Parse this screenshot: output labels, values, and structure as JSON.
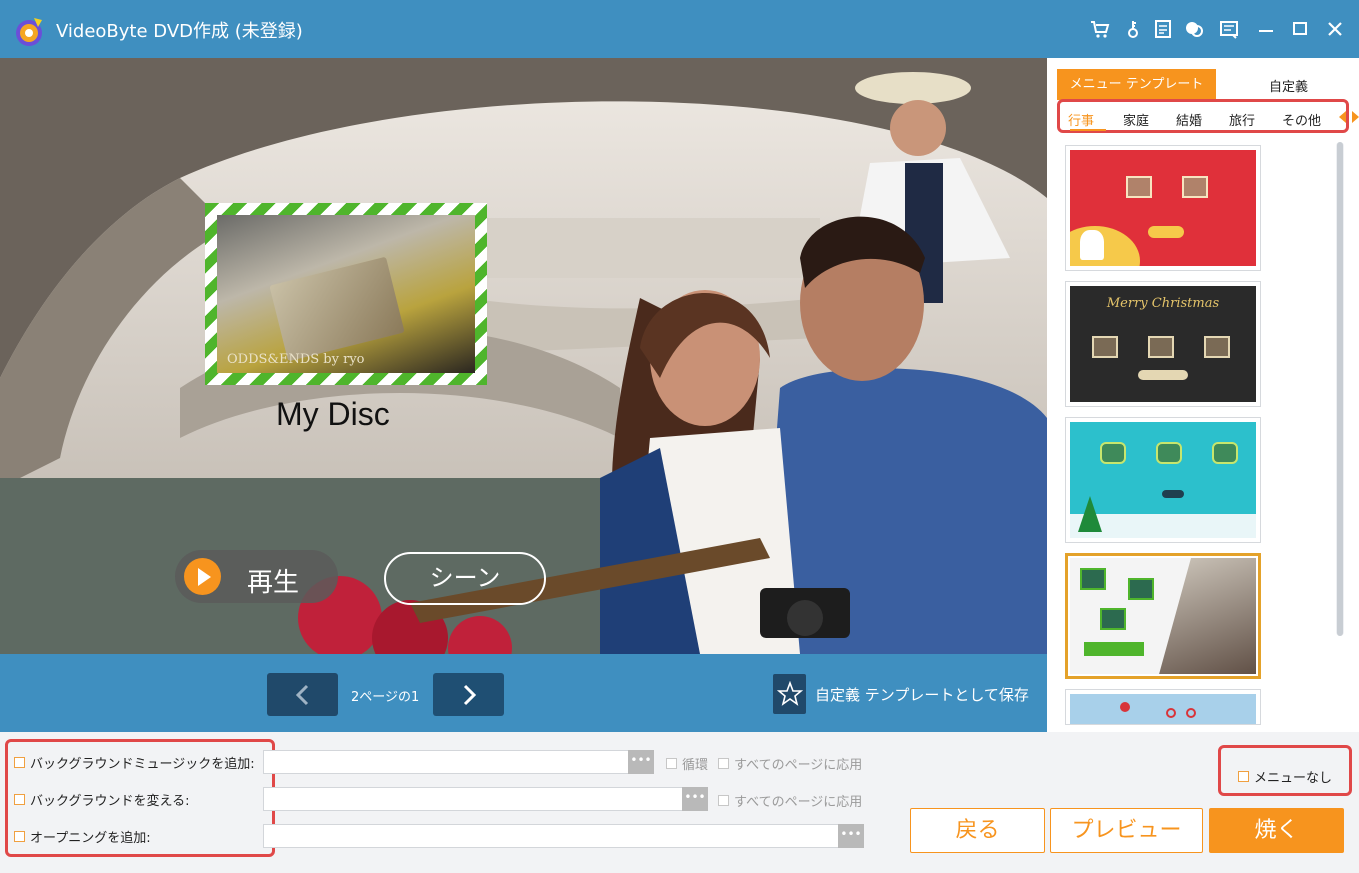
{
  "window": {
    "title": "VideoByte DVD作成 (未登録)",
    "toolbar_icons": [
      "cart-icon",
      "key-icon",
      "document-icon",
      "chat-icon",
      "feedback-icon",
      "minimize-icon",
      "maximize-icon",
      "close-icon"
    ]
  },
  "preview": {
    "disc_title": "My Disc",
    "thumbnail_caption": "ODDS&ENDS by ryo",
    "play_label": "再生",
    "scene_label": "シーン"
  },
  "pager": {
    "page_label": "2ページの1",
    "save_template_label": "自定義 テンプレートとして保存"
  },
  "panel": {
    "tab_menu_template": "メニュー テンプレート",
    "tab_custom": "自定義",
    "categories": [
      "行事",
      "家庭",
      "結婚",
      "旅行",
      "その他"
    ],
    "active_category": "行事",
    "selected_template_index": 3,
    "template_texts": {
      "christmas_script": "Merry Christmas"
    }
  },
  "options": {
    "add_bgm_label": "バックグラウンドミュージックを追加:",
    "change_bg_label": "バックグラウンドを変える:",
    "add_opening_label": "オープニングを追加:",
    "loop_label": "循環",
    "apply_all_label": "すべてのページに応用",
    "browse_label": "•••",
    "no_menu_label": "メニューなし"
  },
  "actions": {
    "back": "戻る",
    "preview": "プレビュー",
    "burn": "焼く"
  },
  "colors": {
    "accent": "#f7941e",
    "titlebar": "#3f8fc0",
    "highlight_border": "#e04848"
  }
}
